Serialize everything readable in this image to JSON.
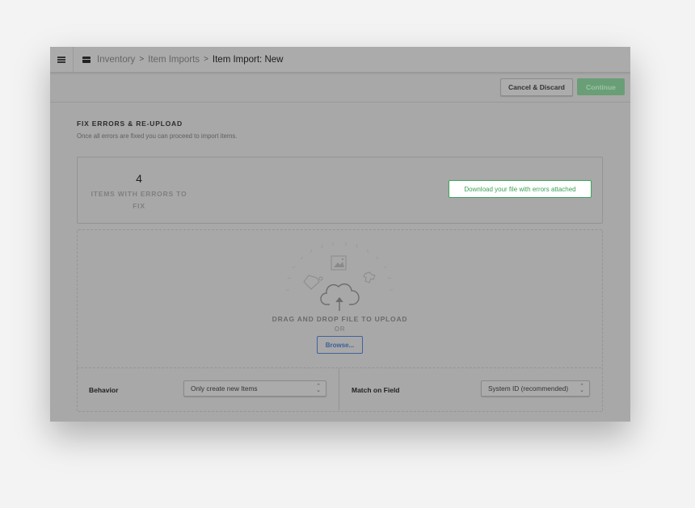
{
  "header": {
    "menu_icon": "hamburger-icon",
    "section_icon": "inventory-box-icon",
    "breadcrumb": [
      {
        "label": "Inventory"
      },
      {
        "label": "Item Imports"
      }
    ],
    "separator": ">",
    "current": "Item Import: New"
  },
  "toolbar": {
    "cancel_label": "Cancel & Discard",
    "continue_label": "Continue"
  },
  "section": {
    "title": "FIX ERRORS & RE-UPLOAD",
    "subtitle": "Once all errors are fixed you can proceed to import items."
  },
  "errors": {
    "count": "4",
    "label": "ITEMS WITH ERRORS TO FIX",
    "download_label": "Download your file with errors attached"
  },
  "upload": {
    "icons": [
      "image-icon",
      "tag-icon",
      "shirt-icon",
      "cloud-upload-icon"
    ],
    "drag_text": "DRAG AND DROP FILE TO UPLOAD",
    "or_text": "OR",
    "browse_label": "Browse..."
  },
  "options": {
    "behavior": {
      "label": "Behavior",
      "value": "Only create new Items"
    },
    "match": {
      "label": "Match on Field",
      "value": "System ID (recommended)"
    }
  },
  "colors": {
    "accent_green": "#3aa157",
    "accent_blue": "#3a5f9b",
    "page_background": "#f3f3f3"
  }
}
